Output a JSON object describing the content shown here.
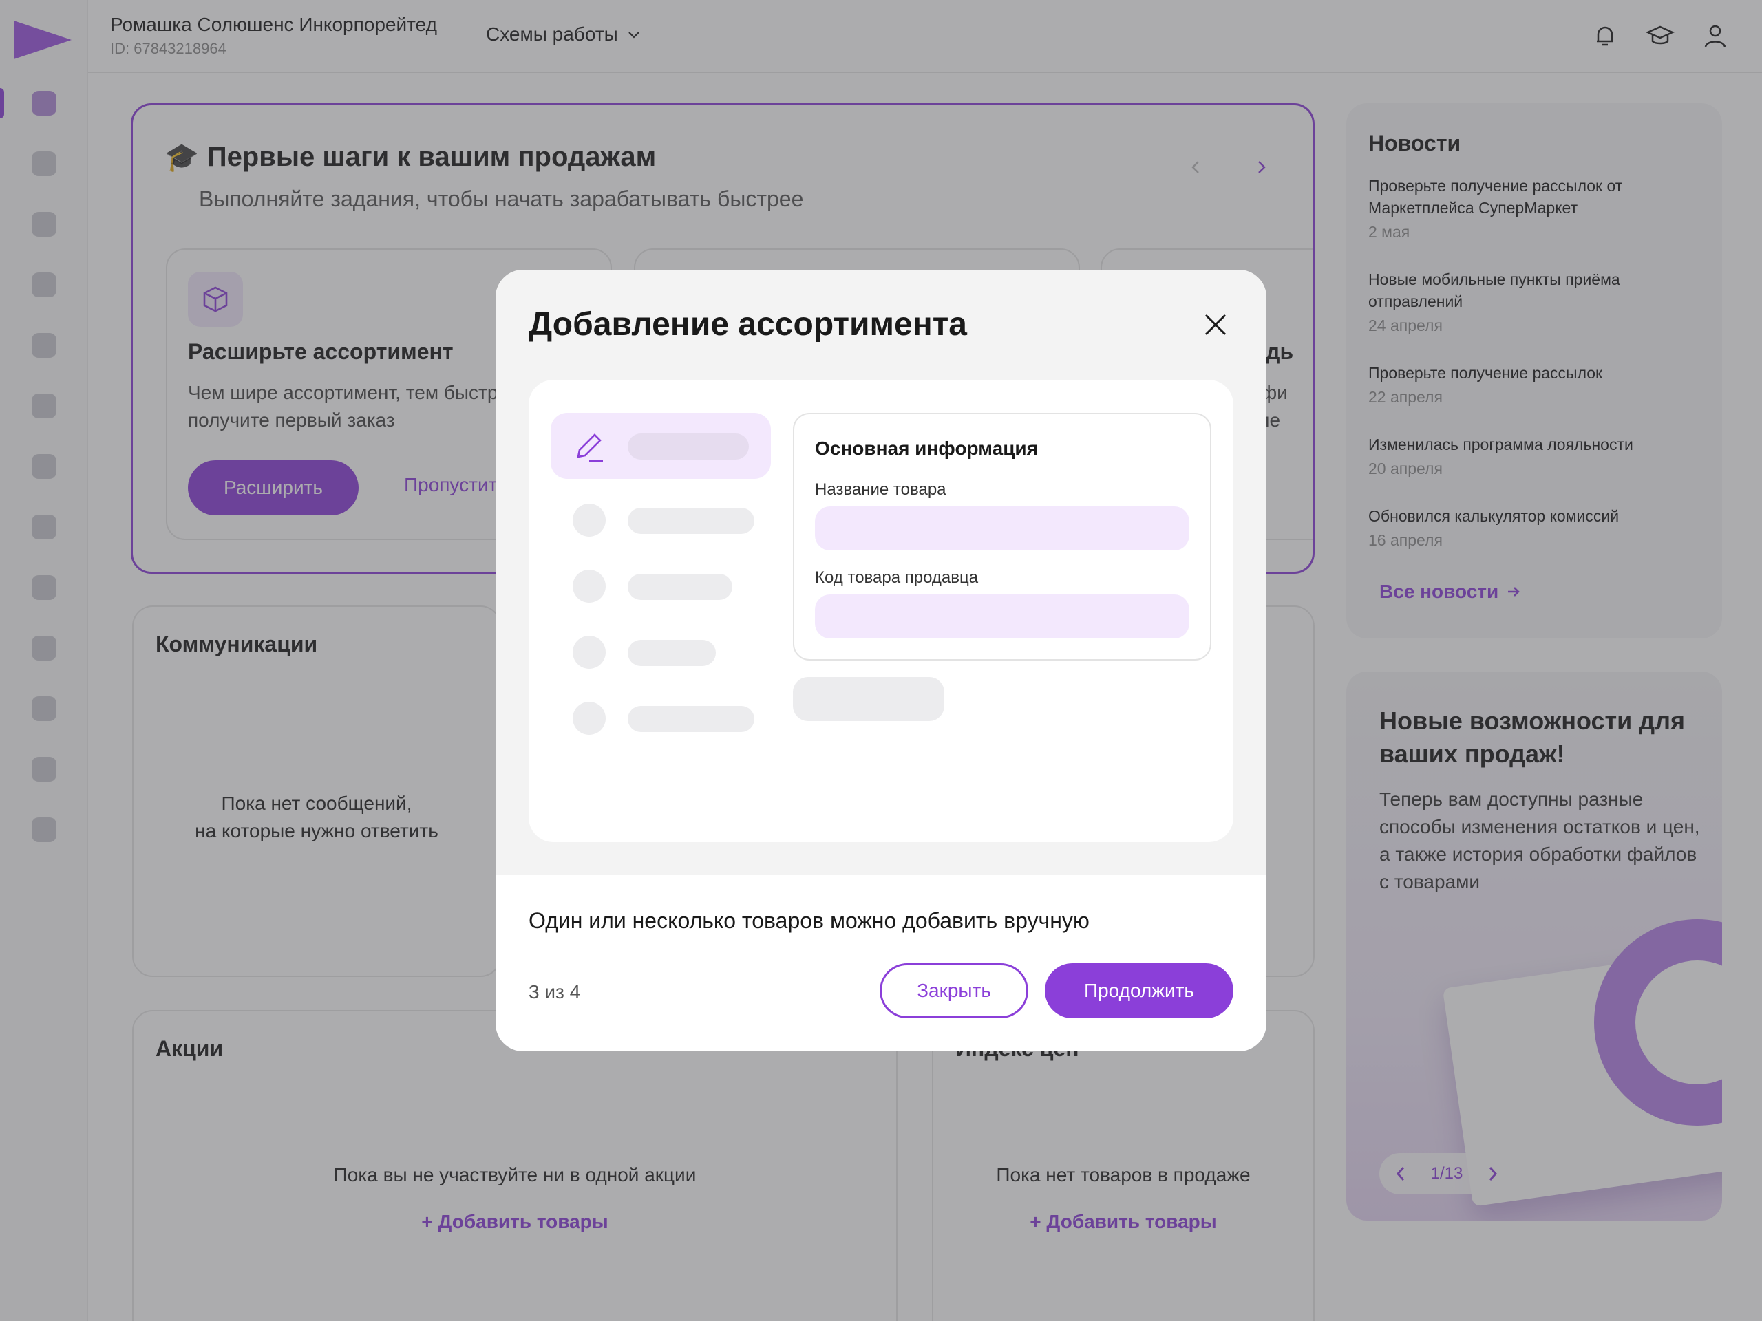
{
  "header": {
    "company_name": "Ромашка Солюшенс Инкорпорейтед",
    "company_id": "ID: 67843218964",
    "scheme_label": "Схемы работы",
    "icons": [
      "bell-icon",
      "graduation-cap-icon",
      "user-icon"
    ]
  },
  "steps": {
    "title": "Первые шаги к вашим продажам",
    "subtitle": "Выполняйте задания, чтобы начать зарабатывать быстрее",
    "tasks": [
      {
        "title": "Расширьте ассортимент",
        "text": "Чем шире ассортимент, тем быстрее вы получите первый заказ",
        "primary_label": "Расширить",
        "link_label": "Пропустить"
      },
      {
        "title": ""
      },
      {
        "title_fragment": "ладь",
        "text_fragment_1": "рафи",
        "text_fragment_2": "теле"
      }
    ]
  },
  "news": {
    "title": "Новости",
    "items": [
      {
        "title": "Проверьте получение рассылок от Маркетплейса СуперМаркет",
        "date": "2 мая"
      },
      {
        "title": "Новые мобильные пункты приёма отправлений",
        "date": "24 апреля"
      },
      {
        "title": "Проверьте получение рассылок",
        "date": "22 апреля"
      },
      {
        "title": "Изменилась программа лояльности",
        "date": "20 апреля"
      },
      {
        "title": "Обновился калькулятор комиссий",
        "date": "16 апреля"
      }
    ],
    "all_label": "Все новости"
  },
  "promo": {
    "title": "Новые возможности для ваших продаж!",
    "text": "Теперь вам доступны разные способы изменения остатков и цен, а также история обработки файлов с товарами",
    "pager": "1/13"
  },
  "communications": {
    "title": "Коммуникации",
    "empty_line1": "Пока нет сообщений,",
    "empty_line2": "на которые нужно ответить"
  },
  "akcii": {
    "title": "Акции",
    "empty": "Пока вы не участвуйте ни в одной акции",
    "add_label": "+ Добавить товары"
  },
  "price_index": {
    "title": "Индекс цен",
    "empty": "Пока нет товаров в продаже",
    "add_label": "+ Добавить товары"
  },
  "modal": {
    "title": "Добавление ассортимента",
    "illustration": {
      "form_title": "Основная информация",
      "field1_label": "Название товара",
      "field2_label": "Код товара продавца"
    },
    "description": "Один или несколько товаров можно добавить вручную",
    "step": "3 из 4",
    "close_label": "Закрыть",
    "continue_label": "Продолжить"
  },
  "colors": {
    "accent": "#8b3fd9",
    "accent_light": "#f3e8fd",
    "overlay": "rgba(70,70,75,0.45)"
  }
}
